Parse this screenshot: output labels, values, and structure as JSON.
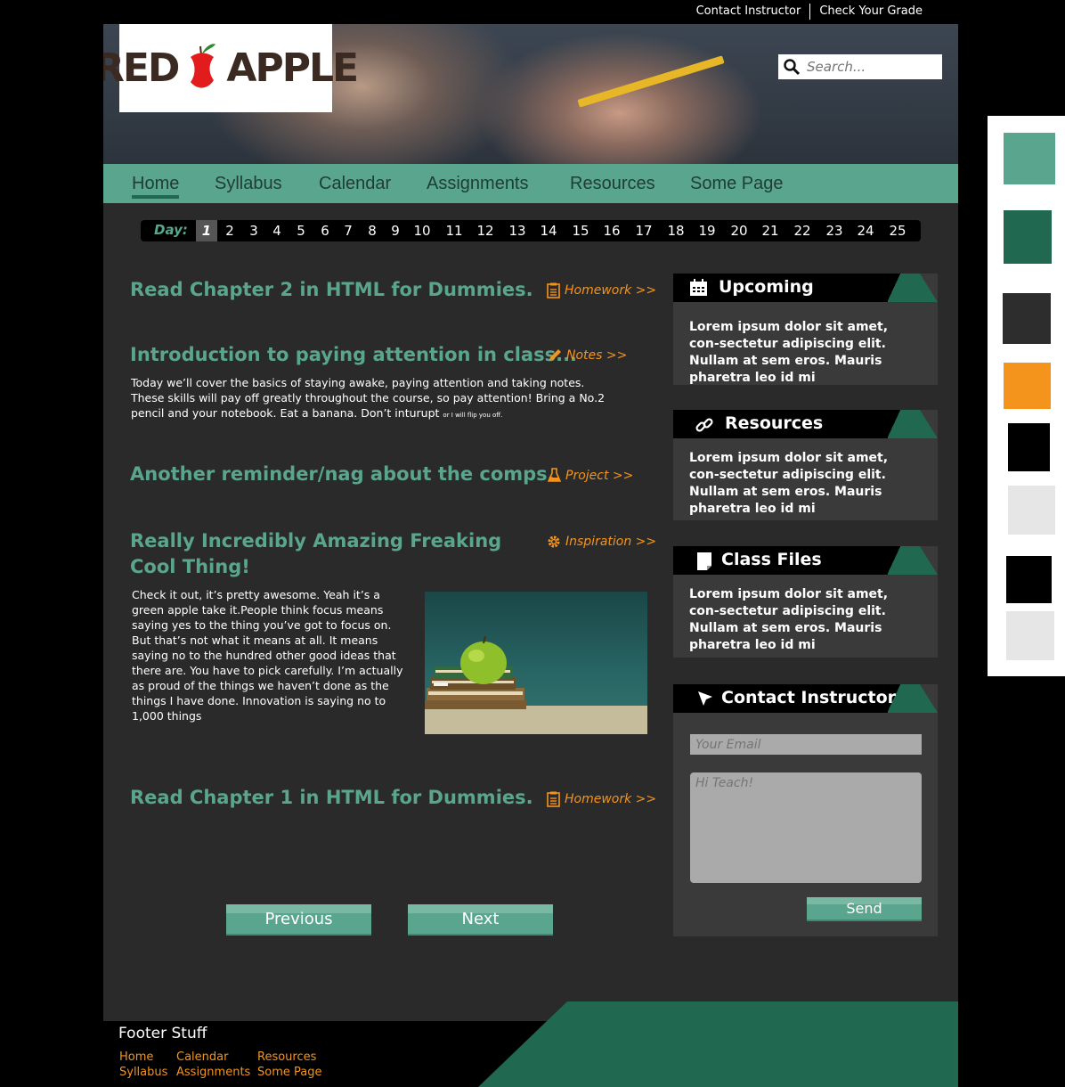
{
  "top_links": [
    "Contact Instructor",
    "Check Your Grade"
  ],
  "logo": {
    "text_left": "RED",
    "text_right": "APPLE"
  },
  "search": {
    "placeholder": "Search..."
  },
  "nav": [
    "Home",
    "Syllabus",
    "Calendar",
    "Assignments",
    "Resources",
    "Some Page"
  ],
  "nav_active": "Home",
  "days": {
    "label": "Day:",
    "items": [
      "1",
      "2",
      "3",
      "4",
      "5",
      "6",
      "7",
      "8",
      "9",
      "10",
      "11",
      "12",
      "13",
      "14",
      "15",
      "16",
      "17",
      "18",
      "19",
      "20",
      "21",
      "22",
      "23",
      "24",
      "25"
    ],
    "active": "1"
  },
  "posts": [
    {
      "title": "Read Chapter 2 in HTML for Dummies.",
      "link": "Homework >>",
      "link_icon": "clipboard-icon"
    },
    {
      "title": "Introduction to paying attention in class...",
      "link": "Notes >>",
      "link_icon": "pencil-icon",
      "body": "Today we’ll cover the basics of staying awake, paying attention and taking notes. These skills will pay off greatly throughout the course, so pay attention! Bring a No.2 pencil and your notebook. Eat a banana. Don’t inturupt",
      "fineprint": "or I will flip you off."
    },
    {
      "title": "Another reminder/nag about the comps.",
      "link": "Project >>",
      "link_icon": "flask-icon"
    },
    {
      "title_line1": "Really Incredibly Amazing Freaking",
      "title_line2": "Cool Thing!",
      "link": "Inspiration >>",
      "link_icon": "gear-icon",
      "body": "Check it out, it’s pretty awesome. Yeah it’s a green apple take it.People think focus means saying yes to the thing you’ve got to focus on. But that’s not what it means at all. It means saying no to the hundred other good ideas that there are. You have to pick carefully. I’m actually as proud of the things we haven’t done as the things I have done. Innovation is saying no to 1,000 things"
    },
    {
      "title": "Read Chapter 1 in HTML for Dummies.",
      "link": "Homework >>",
      "link_icon": "clipboard-icon"
    }
  ],
  "pager": {
    "previous": "Previous",
    "next": "Next"
  },
  "widgets": [
    {
      "title": "Upcoming",
      "icon": "calendar-icon",
      "body": "Lorem ipsum dolor sit amet, con-sectetur adipiscing elit. Nullam at sem eros. Mauris pharetra leo id mi"
    },
    {
      "title": "Resources",
      "icon": "link-icon",
      "body": "Lorem ipsum dolor sit amet, con-sectetur adipiscing elit. Nullam at sem eros. Mauris pharetra leo id mi"
    },
    {
      "title": "Class Files",
      "icon": "file-icon",
      "body": "Lorem ipsum dolor sit amet, con-sectetur adipiscing elit. Nullam at sem eros. Mauris pharetra leo id mi"
    }
  ],
  "contact": {
    "title": "Contact Instructor",
    "icon": "cursor-icon",
    "email_placeholder": "Your Email",
    "message_placeholder": "Hi Teach!",
    "send": "Send"
  },
  "footer": {
    "title": "Footer Stuff",
    "col1": [
      "Home",
      "Syllabus"
    ],
    "col2": [
      "Calendar",
      "Assignments"
    ],
    "col3": [
      "Resources",
      "Some Page"
    ]
  },
  "palette": [
    "#5aa58d",
    "#20684f",
    "#2d2d2d",
    "#f4941c",
    "#000000",
    "#e6e6e6",
    "#000000",
    "#e6e6e6"
  ]
}
